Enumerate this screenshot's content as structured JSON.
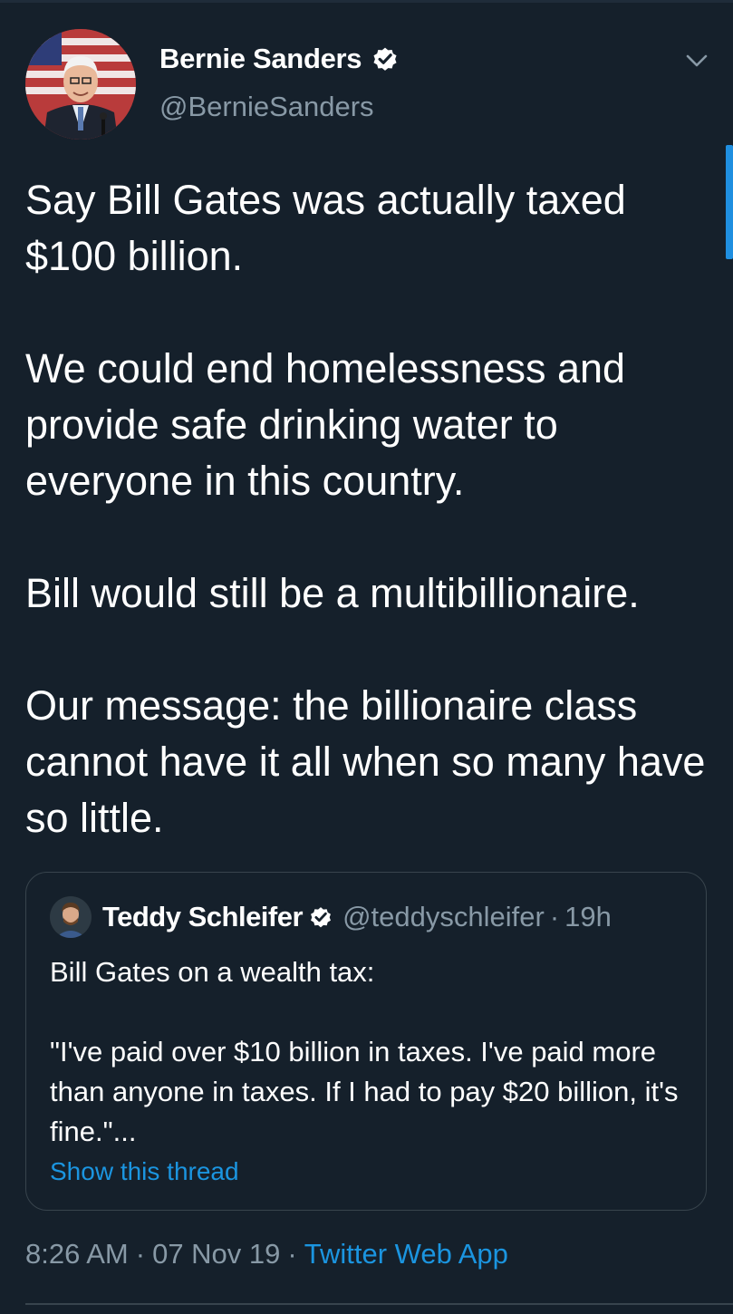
{
  "author": {
    "display_name": "Bernie Sanders",
    "handle": "@BernieSanders",
    "verified": true
  },
  "tweet": {
    "paragraphs": [
      "Say Bill Gates was actually taxed $100 billion.",
      "We could end homelessness and provide safe drinking water to everyone in this country.",
      "Bill would still be a multibillionaire.",
      "Our message: the billionaire class cannot have it all when so many have so little."
    ]
  },
  "quoted": {
    "display_name": "Teddy Schleifer",
    "handle": "@teddyschleifer",
    "separator": "·",
    "time": "19h",
    "line1": "Bill Gates on a wealth tax:",
    "line2": "\"I've paid over $10 billion in taxes. I've paid more than anyone in taxes. If I had to pay $20 billion, it's fine.\"...",
    "show_thread": "Show this thread"
  },
  "meta": {
    "time": "8:26 AM",
    "date": "07 Nov 19",
    "separator": "·",
    "source": "Twitter Web App"
  },
  "icons": {
    "verified": "verified-badge-icon",
    "more": "chevron-down-icon"
  },
  "colors": {
    "background": "#15202b",
    "accent": "#1b95e0",
    "muted": "#8899a6",
    "border": "#38444d"
  }
}
